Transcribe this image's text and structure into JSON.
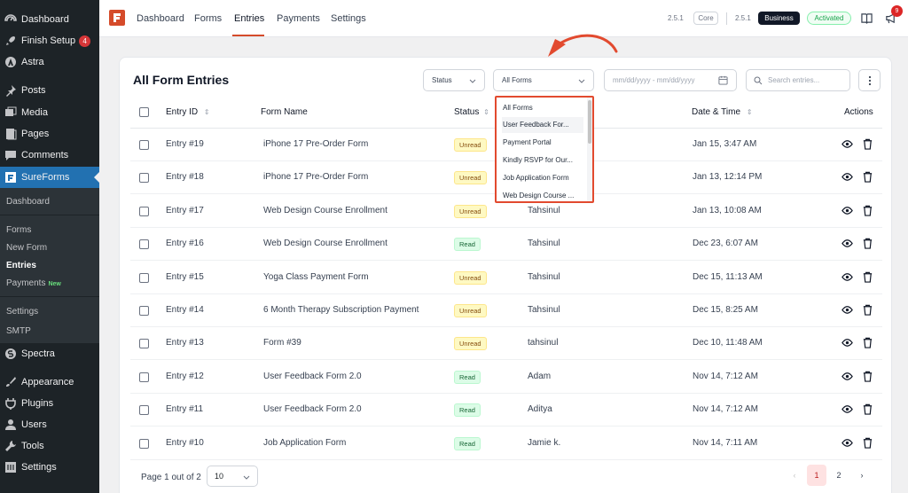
{
  "sidebar": {
    "items": [
      {
        "label": "Dashboard",
        "icon": "dashboard-icon"
      },
      {
        "label": "Finish Setup",
        "icon": "rocket-icon",
        "badge": "4"
      },
      {
        "label": "Astra",
        "icon": "astra-icon"
      },
      {
        "label": "Posts",
        "icon": "pin-icon"
      },
      {
        "label": "Media",
        "icon": "media-icon"
      },
      {
        "label": "Pages",
        "icon": "page-icon"
      },
      {
        "label": "Comments",
        "icon": "comment-icon"
      },
      {
        "label": "SureForms",
        "icon": "sureforms-icon"
      }
    ],
    "sub": {
      "dashboard": "Dashboard",
      "forms": "Forms",
      "new_form": "New Form",
      "entries": "Entries",
      "payments": "Payments",
      "payments_new": "New",
      "settings": "Settings",
      "smtp": "SMTP"
    },
    "bottom_items": [
      {
        "label": "Spectra",
        "icon": "spectra-icon"
      },
      {
        "label": "Appearance",
        "icon": "brush-icon"
      },
      {
        "label": "Plugins",
        "icon": "plugin-icon"
      },
      {
        "label": "Users",
        "icon": "users-icon"
      },
      {
        "label": "Tools",
        "icon": "wrench-icon"
      },
      {
        "label": "Settings",
        "icon": "settings-icon"
      }
    ]
  },
  "topnav": {
    "links": [
      "Dashboard",
      "Forms",
      "Entries",
      "Payments",
      "Settings"
    ],
    "active": "Entries",
    "core_version": "2.5.1",
    "core_label": "Core",
    "pro_version": "2.5.1",
    "plan_label": "Business",
    "status_label": "Activated",
    "notif_count": "9"
  },
  "page": {
    "title": "All Form Entries",
    "status_filter": "Status",
    "form_filter": "All Forms",
    "date_placeholder": "mm/dd/yyyy - mm/dd/yyyy",
    "search_placeholder": "Search entries..."
  },
  "table": {
    "headers": {
      "id": "Entry ID",
      "form": "Form Name",
      "status": "Status",
      "date": "Date & Time",
      "actions": "Actions"
    },
    "rows": [
      {
        "id": "Entry #19",
        "form": "iPhone 17 Pre-Order Form",
        "status": "Unread",
        "user": "",
        "date": "Jan 15, 3:47 AM"
      },
      {
        "id": "Entry #18",
        "form": "iPhone 17 Pre-Order Form",
        "status": "Unread",
        "user": "",
        "date": "Jan 13, 12:14 PM"
      },
      {
        "id": "Entry #17",
        "form": "Web Design Course Enrollment",
        "status": "Unread",
        "user": "Tahsinul",
        "date": "Jan 13, 10:08 AM"
      },
      {
        "id": "Entry #16",
        "form": "Web Design Course Enrollment",
        "status": "Read",
        "user": "Tahsinul",
        "date": "Dec 23, 6:07 AM"
      },
      {
        "id": "Entry #15",
        "form": "Yoga Class Payment Form",
        "status": "Unread",
        "user": "Tahsinul",
        "date": "Dec 15, 11:13 AM"
      },
      {
        "id": "Entry #14",
        "form": "6 Month Therapy Subscription Payment",
        "status": "Unread",
        "user": "Tahsinul",
        "date": "Dec 15, 8:25 AM"
      },
      {
        "id": "Entry #13",
        "form": "Form #39",
        "status": "Unread",
        "user": "tahsinul",
        "date": "Dec 10, 11:48 AM"
      },
      {
        "id": "Entry #12",
        "form": "User Feedback Form 2.0",
        "status": "Read",
        "user": "Adam",
        "date": "Nov 14, 7:12 AM"
      },
      {
        "id": "Entry #11",
        "form": "User Feedback Form 2.0",
        "status": "Read",
        "user": "Aditya",
        "date": "Nov 14, 7:12 AM"
      },
      {
        "id": "Entry #10",
        "form": "Job Application Form",
        "status": "Read",
        "user": "Jamie k.",
        "date": "Nov 14, 7:11 AM"
      }
    ]
  },
  "pagination": {
    "text": "Page 1 out of 2",
    "per_page": "10",
    "current": "1",
    "next": "2"
  },
  "dropdown": {
    "options": [
      "All Forms",
      "User Feedback For...",
      "Payment Portal",
      "Kindly RSVP for Our...",
      "Job Application Form",
      "Web Design Course ..."
    ],
    "highlighted": "User Feedback For..."
  },
  "colors": {
    "accent": "#d54b2a",
    "wp_blue": "#2271b1",
    "wp_dark": "#1d2327",
    "highlight_red": "#e24a2f"
  }
}
